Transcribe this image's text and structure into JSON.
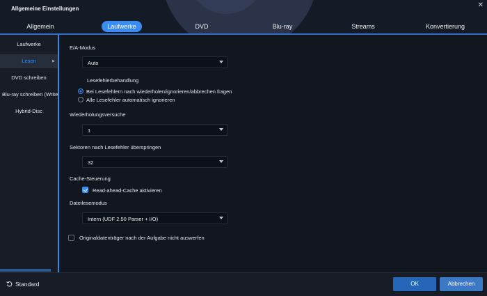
{
  "window": {
    "title": "Allgemeine Einstellungen",
    "close_glyph": "✕"
  },
  "tabs": [
    {
      "label": "Allgemein"
    },
    {
      "label": "Laufwerke",
      "active": true
    },
    {
      "label": "DVD"
    },
    {
      "label": "Blu-ray"
    },
    {
      "label": "Streams"
    },
    {
      "label": "Konvertierung"
    }
  ],
  "sidebar": {
    "items": [
      {
        "label": "Laufwerke"
      },
      {
        "label": "Lesen",
        "active": true
      },
      {
        "label": "DVD schreiben"
      },
      {
        "label": "Blu-ray schreiben (Write"
      },
      {
        "label": "Hybrid-Disc"
      }
    ]
  },
  "settings": {
    "io_mode": {
      "label": "E/A-Modus",
      "value": "Auto"
    },
    "read_error": {
      "label": "Lesefehlerbehandlung",
      "options": [
        {
          "label": "Bei Lesefehlern nach wiederholen/ignorieren/abbrechen fragen",
          "selected": true
        },
        {
          "label": "Alle Lesefehler automatisch ignorieren",
          "selected": false
        }
      ]
    },
    "retries": {
      "label": "Wiederholungsversuche",
      "value": "1"
    },
    "skip_sectors": {
      "label": "Sektoren nach Lesefehler überspringen",
      "value": "32"
    },
    "cache": {
      "label": "Cache-Steuerung",
      "checkbox_label": "Read-ahead-Cache aktivieren",
      "checked": true
    },
    "file_read_mode": {
      "label": "Dateilesemodus",
      "value": "Intern (UDF 2.50 Parser + I/O)"
    },
    "no_eject": {
      "label": "Originaldatenträger nach der Aufgabe nicht auswerfen",
      "checked": false
    }
  },
  "footer": {
    "standard_label": "Standard",
    "ok_label": "OK",
    "cancel_label": "Abbrechen"
  },
  "colors": {
    "accent": "#3b8cf0",
    "background": "#11161f",
    "sidebar": "#171c26"
  }
}
